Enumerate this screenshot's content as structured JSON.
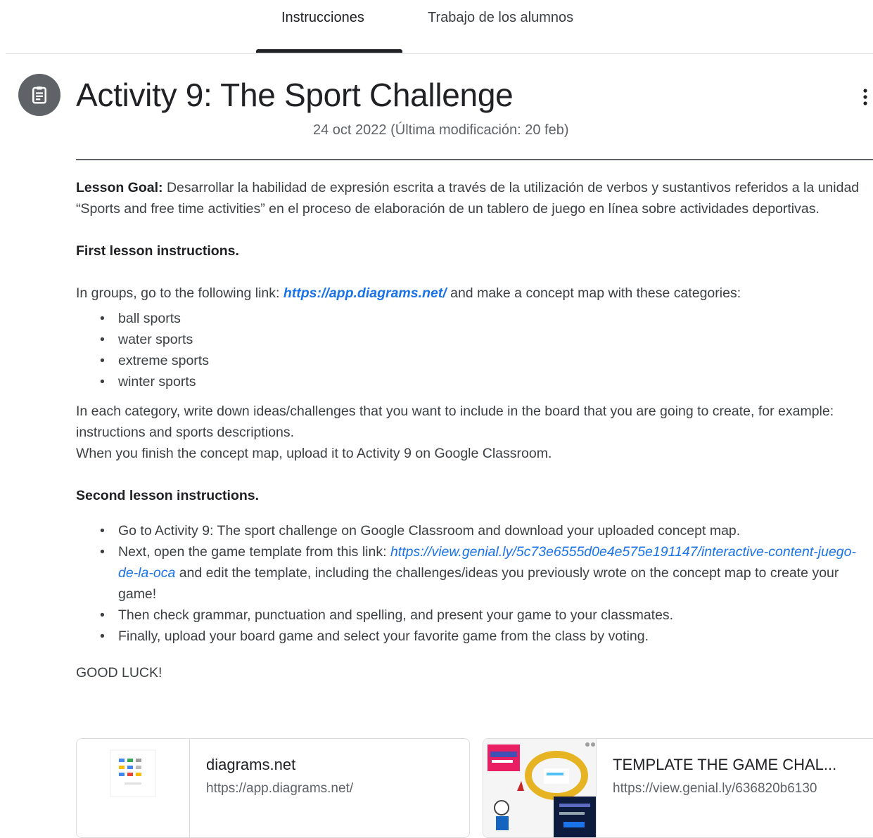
{
  "tabs": [
    {
      "label": "Instrucciones",
      "active": true
    },
    {
      "label": "Trabajo de los alumnos",
      "active": false
    }
  ],
  "assignment": {
    "icon": "assignment-icon",
    "title": "Activity 9: The Sport Challenge",
    "meta": "24 oct 2022 (Última modificación: 20 feb)",
    "more_icon": "more-vert-icon"
  },
  "content": {
    "goal_label": "Lesson Goal:",
    "goal_text": " Desarrollar la habilidad de expresión escrita a través de la utilización de verbos y sustantivos referidos a la unidad “Sports and free time activities” en el proceso de elaboración de un tablero de juego en línea sobre actividades deportivas.",
    "first_heading": "First lesson instructions.",
    "groups_before": "In groups, go to the following link: ",
    "groups_link": "https://app.diagrams.net/",
    "groups_after": " and make a concept map with these categories:",
    "categories": [
      "ball sports",
      "water sports",
      "extreme sports",
      "winter sports"
    ],
    "each_category": "In each category, write down ideas/challenges that you want to include in the board that you are going to create, for example: instructions and sports descriptions.",
    "finish": "When you finish the concept map, upload it to Activity 9 on Google Classroom.",
    "second_heading": "Second lesson instructions.",
    "step1": "Go to Activity 9: The sport challenge on Google Classroom and download your uploaded concept map.",
    "step2_before": "Next, open the game template from this link: ",
    "step2_link": "https://view.genial.ly/5c73e6555d0e4e575e191147/interactive-content-juego-de-la-oca",
    "step2_after": "  and edit the template, including the challenges/ideas you previously wrote on the concept map to create your game!",
    "step3": "Then check grammar, punctuation and spelling, and present your game to your classmates.",
    "step4": "Finally, upload your board game and select your favorite game from the class by voting.",
    "closing": "GOOD LUCK!"
  },
  "attachments": [
    {
      "title": "diagrams.net",
      "url": "https://app.diagrams.net/"
    },
    {
      "title": "TEMPLATE THE GAME CHAL...",
      "url": "https://view.genial.ly/636820b6130"
    }
  ],
  "colors": {
    "accent": "#1a73e8",
    "icon_bg": "#5f6368",
    "text": "#3c4043"
  }
}
